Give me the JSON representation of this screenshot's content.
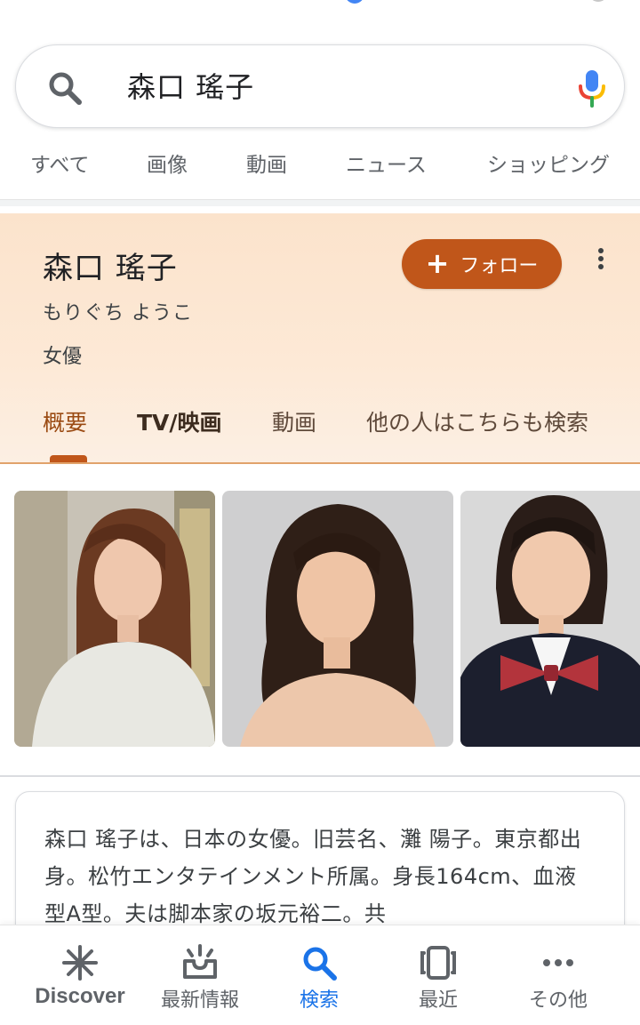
{
  "search": {
    "query": "森口 瑤子"
  },
  "search_tabs": [
    "すべて",
    "画像",
    "動画",
    "ニュース",
    "ショッピング"
  ],
  "knowledge_panel": {
    "title": "森口 瑤子",
    "reading": "もりぐち ようこ",
    "type": "女優",
    "follow_label": "フォロー",
    "tabs": [
      {
        "label": "概要"
      },
      {
        "label": "TV/映画"
      },
      {
        "label": "動画"
      },
      {
        "label": "他の人はこちらも検索"
      }
    ],
    "accent_color": "#c0561a"
  },
  "images": [
    {
      "subject": "woman with long auburn hair in light sweater"
    },
    {
      "subject": "woman with dark wavy hair, bare shoulders"
    },
    {
      "subject": "woman in dark uniform with red bow tie"
    }
  ],
  "description": {
    "text": "森口 瑤子は、日本の女優。旧芸名、灘 陽子。東京都出身。松竹エンタテインメント所属。身長164cm、血液型A型。夫は脚本家の坂元裕二。共"
  },
  "bottom_nav": [
    {
      "label": "Discover",
      "icon": "asterisk-icon"
    },
    {
      "label": "最新情報",
      "icon": "inbox-updates-icon"
    },
    {
      "label": "検索",
      "icon": "search-icon",
      "active": true
    },
    {
      "label": "最近",
      "icon": "recent-tabs-icon"
    },
    {
      "label": "その他",
      "icon": "more-horizontal-icon"
    }
  ],
  "colors": {
    "active_blue": "#1a73e8",
    "panel_background": "#fbe3cc"
  }
}
